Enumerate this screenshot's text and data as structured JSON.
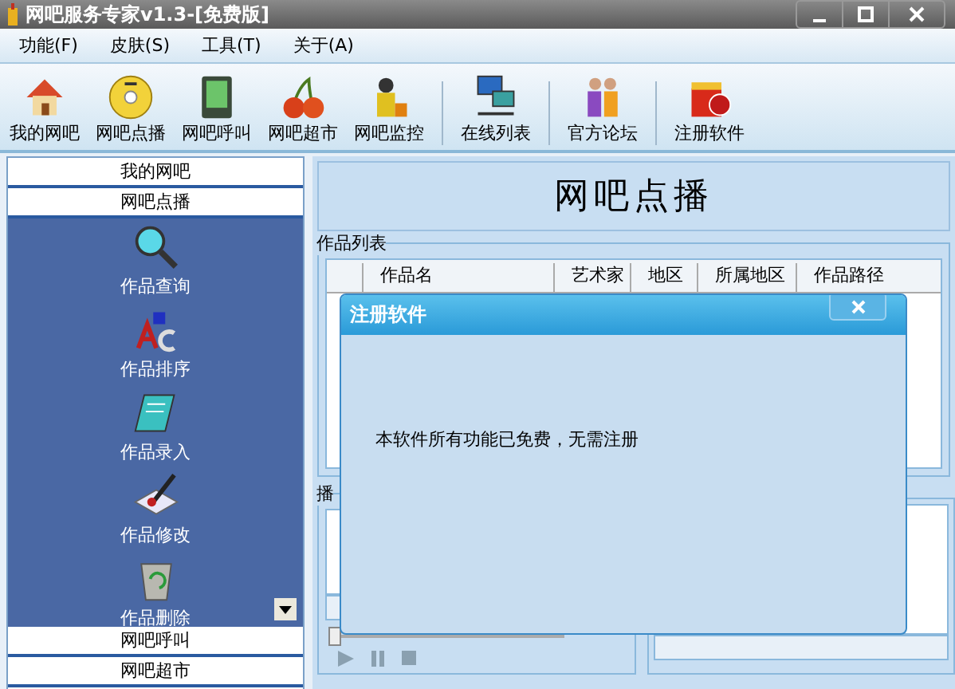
{
  "window": {
    "title": "网吧服务专家v1.3-[免费版]"
  },
  "menu": [
    {
      "label": "功能(F)"
    },
    {
      "label": "皮肤(S)"
    },
    {
      "label": "工具(T)"
    },
    {
      "label": "关于(A)"
    }
  ],
  "toolbar": [
    {
      "label": "我的网吧",
      "kind": "house",
      "group_start": false
    },
    {
      "label": "网吧点播",
      "kind": "disc",
      "group_start": false
    },
    {
      "label": "网吧呼叫",
      "kind": "device",
      "group_start": false
    },
    {
      "label": "网吧超市",
      "kind": "cherry",
      "group_start": false
    },
    {
      "label": "网吧监控",
      "kind": "guard",
      "group_start": false
    },
    {
      "label": "在线列表",
      "kind": "network",
      "group_start": true
    },
    {
      "label": "官方论坛",
      "kind": "people",
      "group_start": true
    },
    {
      "label": "注册软件",
      "kind": "gift",
      "group_start": true
    }
  ],
  "sidebar": [
    {
      "label": "我的网吧",
      "expanded": false
    },
    {
      "label": "网吧点播",
      "expanded": true,
      "items": [
        {
          "label": "作品查询",
          "kind": "search"
        },
        {
          "label": "作品排序",
          "kind": "sort"
        },
        {
          "label": "作品录入",
          "kind": "notepad"
        },
        {
          "label": "作品修改",
          "kind": "edit"
        },
        {
          "label": "作品删除",
          "kind": "trash"
        }
      ]
    },
    {
      "label": "网吧呼叫",
      "expanded": false
    },
    {
      "label": "网吧超市",
      "expanded": false
    }
  ],
  "content": {
    "heading": "网吧点播",
    "list_group": {
      "title": "作品列表",
      "columns": [
        "作品名",
        "艺术家",
        "地区",
        "所属地区",
        "作品路径"
      ]
    },
    "play_group": {
      "title": "播"
    },
    "player": {
      "level": 0
    }
  },
  "dialog": {
    "title": "注册软件",
    "message": "本软件所有功能已免费，无需注册"
  }
}
